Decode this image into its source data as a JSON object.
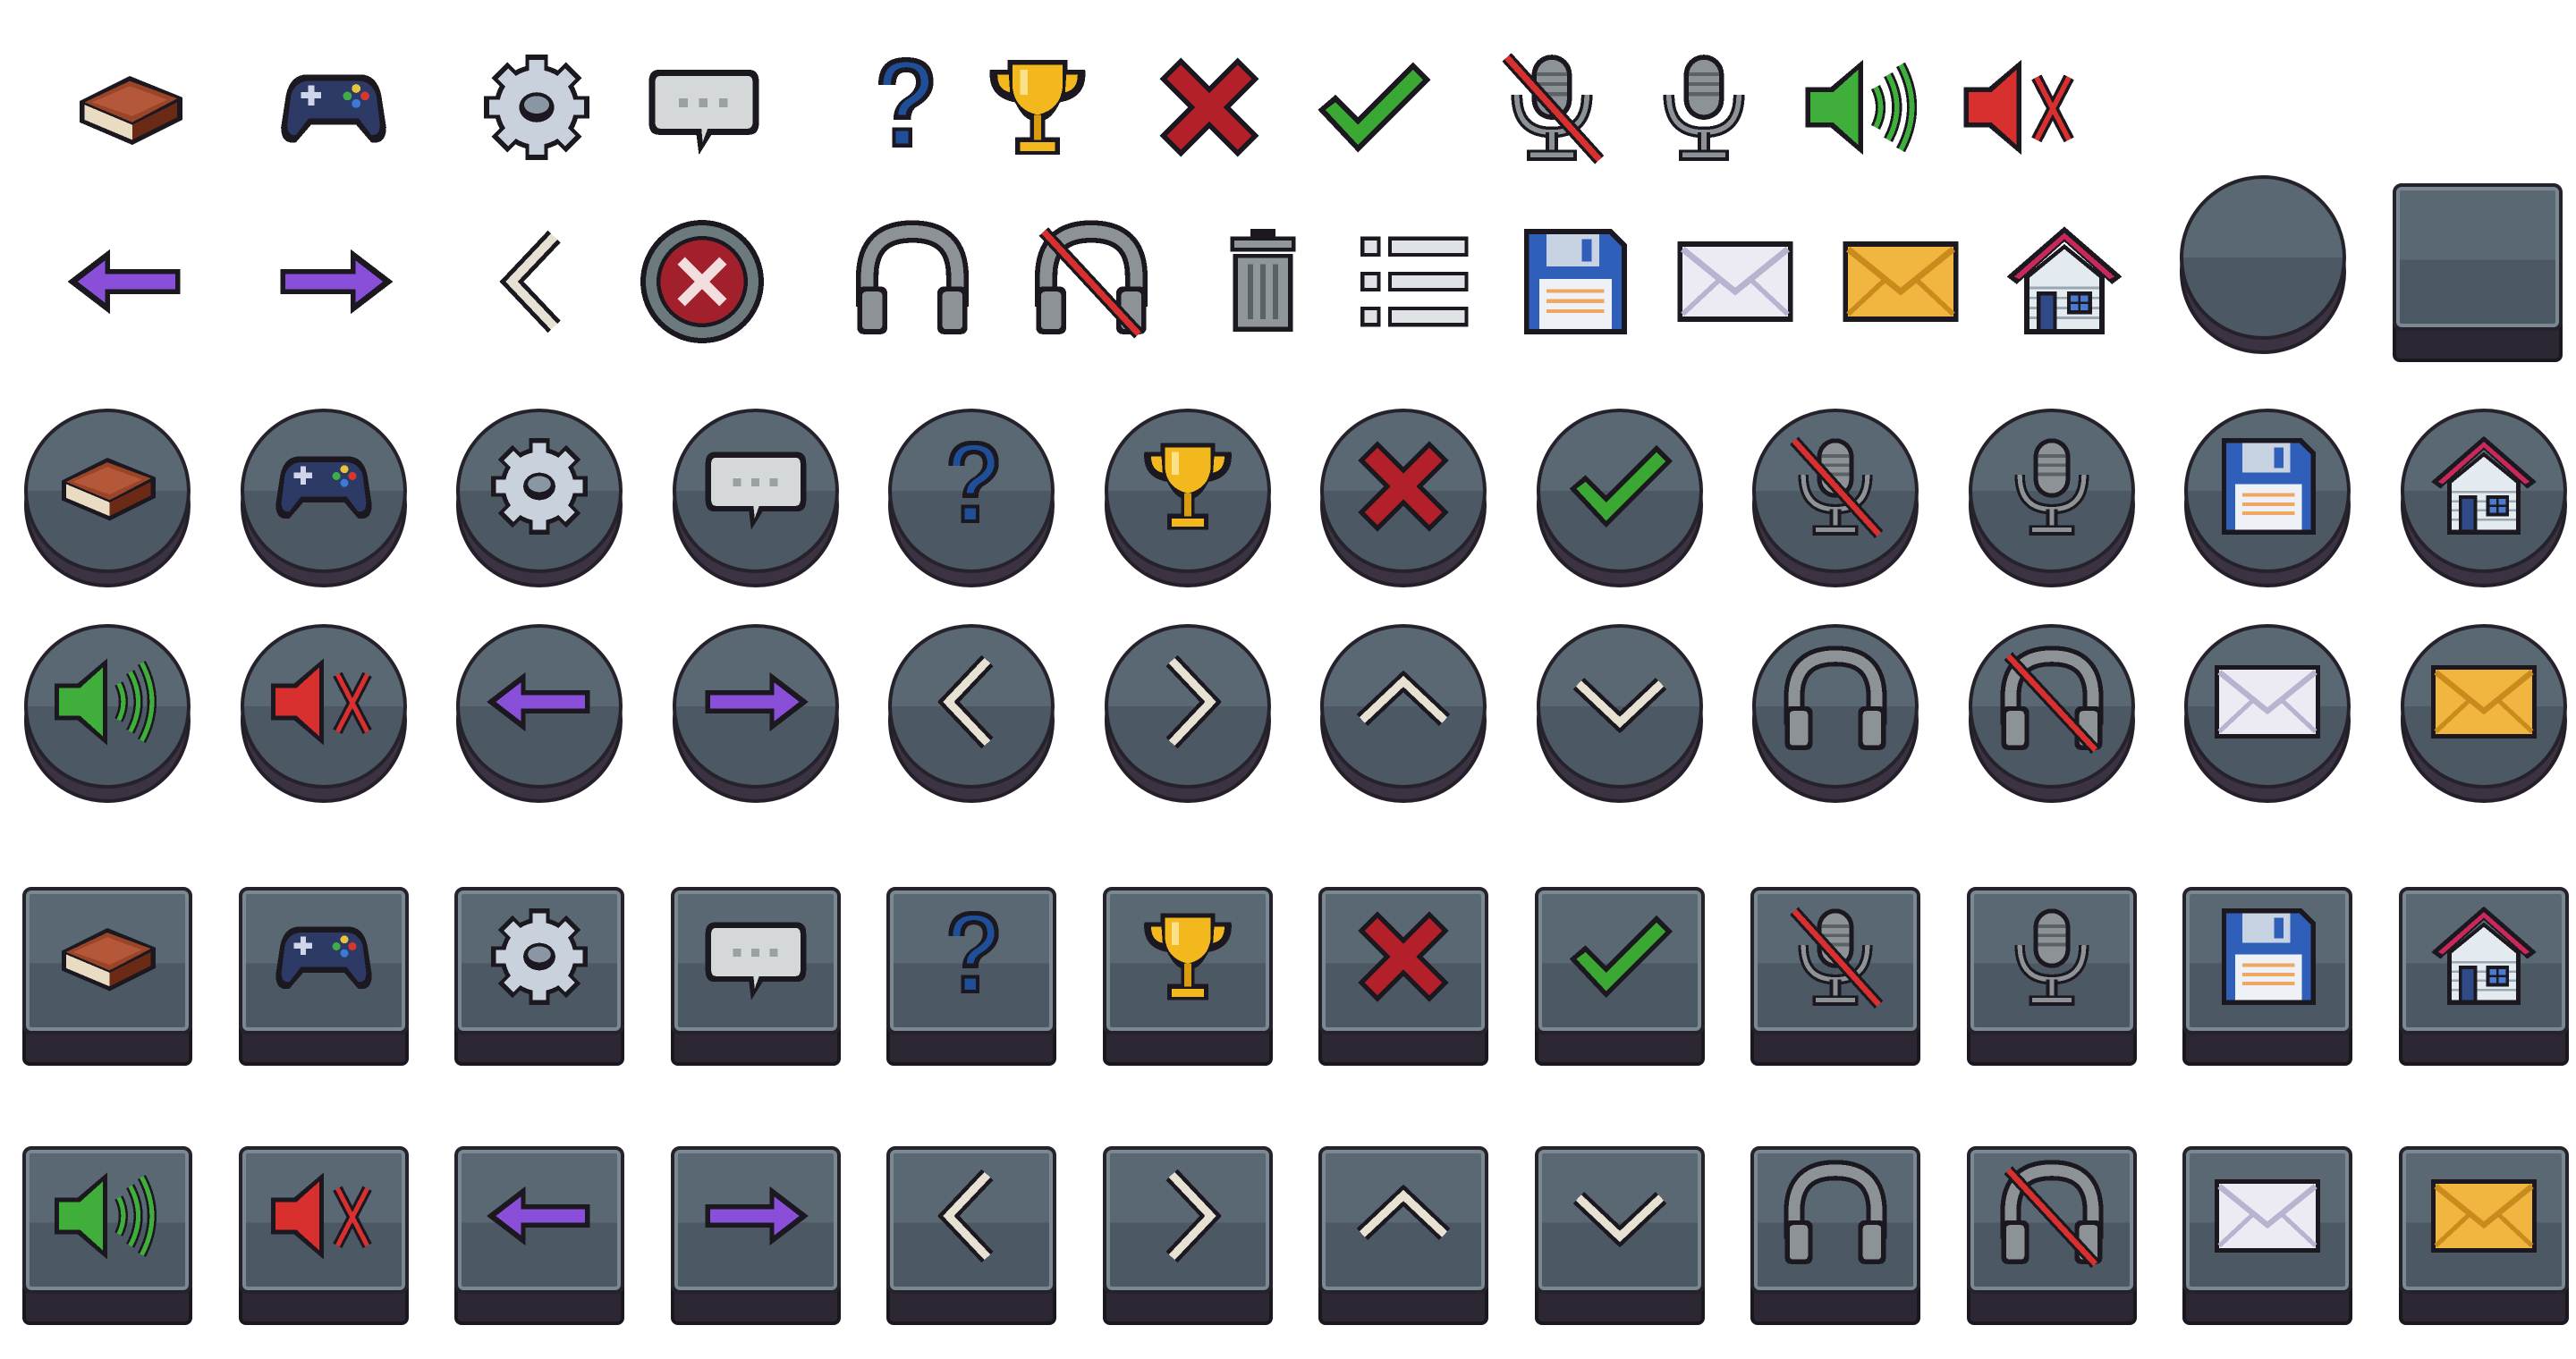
{
  "sheet": {
    "row1_loose_icons": [
      "book-icon",
      "gamepad-icon",
      "gear-icon",
      "speech-bubble-icon",
      "question-mark-icon",
      "trophy-icon",
      "cross-icon",
      "checkmark-icon",
      "microphone-muted-icon",
      "microphone-icon",
      "speaker-on-icon",
      "speaker-muted-icon"
    ],
    "row2_loose_icons": [
      "arrow-left-purple-icon",
      "arrow-right-purple-icon",
      "chevron-left-icon",
      "close-round-button-icon",
      "headphones-icon",
      "headphones-muted-icon",
      "trash-icon",
      "list-icon",
      "floppy-disk-icon",
      "envelope-white-icon",
      "envelope-yellow-icon",
      "house-icon",
      "blank-round-button",
      "blank-square-button"
    ],
    "row3_round_buttons": [
      "book-icon",
      "gamepad-icon",
      "gear-icon",
      "speech-bubble-icon",
      "question-mark-icon",
      "trophy-icon",
      "cross-icon",
      "checkmark-icon",
      "microphone-muted-icon",
      "microphone-icon",
      "floppy-disk-icon",
      "house-icon"
    ],
    "row4_round_buttons": [
      "speaker-on-icon",
      "speaker-muted-icon",
      "arrow-left-purple-icon",
      "arrow-right-purple-icon",
      "chevron-left-icon",
      "chevron-right-icon",
      "chevron-up-icon",
      "chevron-down-icon",
      "headphones-icon",
      "headphones-muted-icon",
      "envelope-white-icon",
      "envelope-yellow-icon"
    ],
    "row5_square_buttons": [
      "book-icon",
      "gamepad-icon",
      "gear-icon",
      "speech-bubble-icon",
      "question-mark-icon",
      "trophy-icon",
      "cross-icon",
      "checkmark-icon",
      "microphone-muted-icon",
      "microphone-icon",
      "floppy-disk-icon",
      "house-icon"
    ],
    "row6_square_buttons": [
      "speaker-on-icon",
      "speaker-muted-icon",
      "arrow-left-purple-icon",
      "arrow-right-purple-icon",
      "chevron-left-icon",
      "chevron-right-icon",
      "chevron-up-icon",
      "chevron-down-icon",
      "headphones-icon",
      "headphones-muted-icon",
      "envelope-white-icon",
      "envelope-yellow-icon"
    ]
  },
  "colors": {
    "button_face_top": "#5a6873",
    "button_face_bottom": "#4c5863",
    "button_base": "#3b3341",
    "outline": "#26222b",
    "book": "#8a3a22",
    "gamepad": "#2e3a66",
    "purple_arrow": "#8a4fd8",
    "green_check": "#3aa832",
    "red_cross": "#b3202a",
    "trophy": "#f2b81e",
    "question": "#1f4f99",
    "floppy": "#2f5fb8",
    "envelope_yellow": "#f0b640",
    "house_roof": "#c8285a"
  }
}
